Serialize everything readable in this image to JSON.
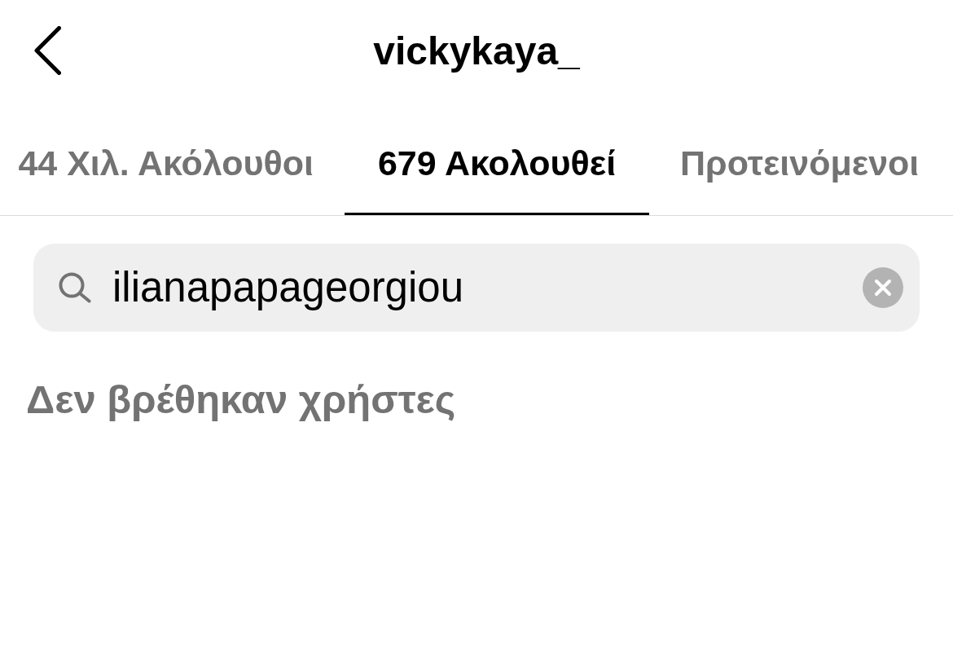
{
  "header": {
    "title": "vickykaya_"
  },
  "tabs": [
    {
      "label": "44 Χιλ. Ακόλουθοι",
      "selected": false
    },
    {
      "label": "679 Ακολουθεί",
      "selected": true
    },
    {
      "label": "Προτεινόμενοι",
      "selected": false
    }
  ],
  "search": {
    "value": "ilianapapageorgiou"
  },
  "empty_message": "Δεν βρέθηκαν χρήστες"
}
